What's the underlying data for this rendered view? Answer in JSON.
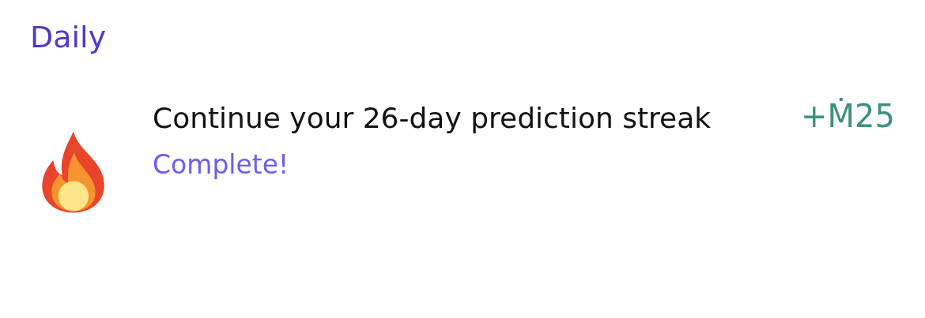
{
  "section": {
    "title": "Daily"
  },
  "tasks": [
    {
      "title": "Continue your 26-day prediction streak",
      "status": "Complete!",
      "reward": "+Ṁ25"
    }
  ]
}
